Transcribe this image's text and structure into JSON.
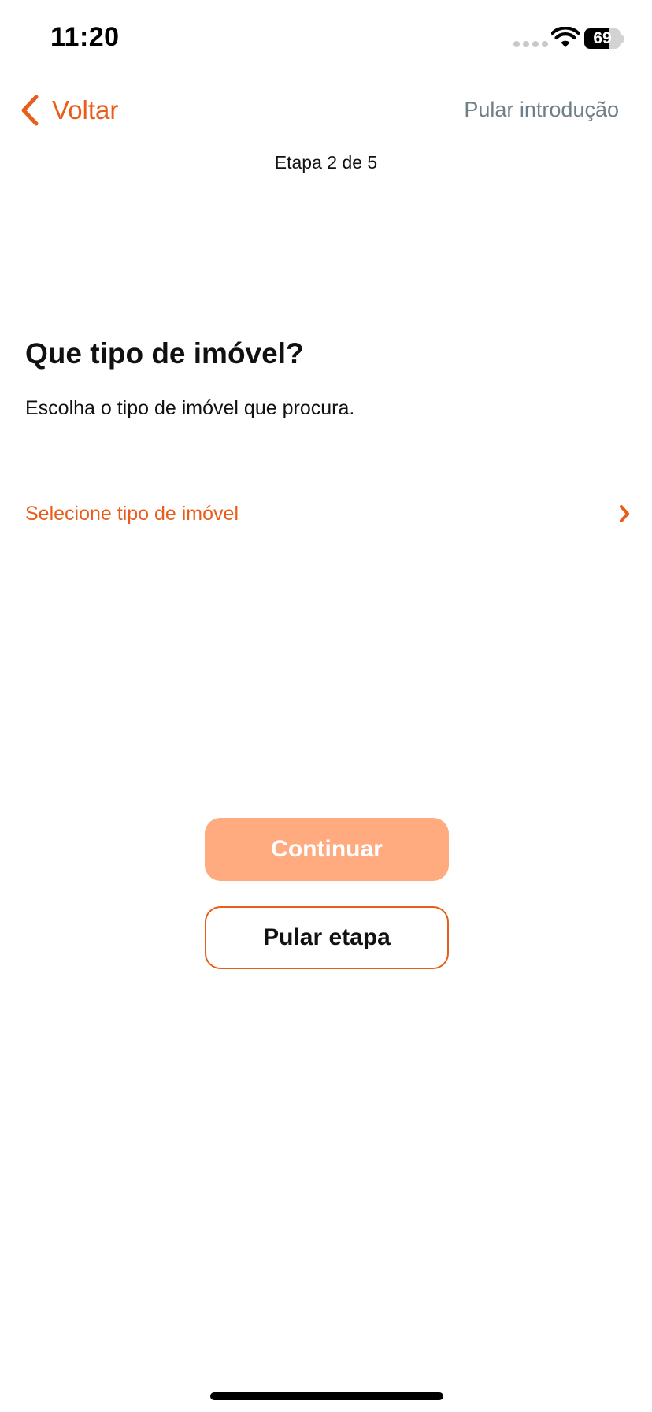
{
  "status_bar": {
    "time": "11:20",
    "battery_level": "69"
  },
  "nav": {
    "back_label": "Voltar",
    "skip_intro_label": "Pular introdução",
    "step_label": "Etapa 2 de 5"
  },
  "content": {
    "title": "Que tipo de imóvel?",
    "subtitle": "Escolha o tipo de imóvel que procura.",
    "select_label": "Selecione tipo de imóvel"
  },
  "actions": {
    "continue_label": "Continuar",
    "continue_enabled": false,
    "skip_step_label": "Pular etapa"
  },
  "colors": {
    "accent": "#e85d1a",
    "accent_disabled": "#ffaa7f",
    "muted_text": "#6f7f88"
  },
  "icons": {
    "back": "chevron-left-icon",
    "select": "chevron-right-icon",
    "wifi": "wifi-icon",
    "battery": "battery-icon",
    "signal": "signal-icon"
  }
}
